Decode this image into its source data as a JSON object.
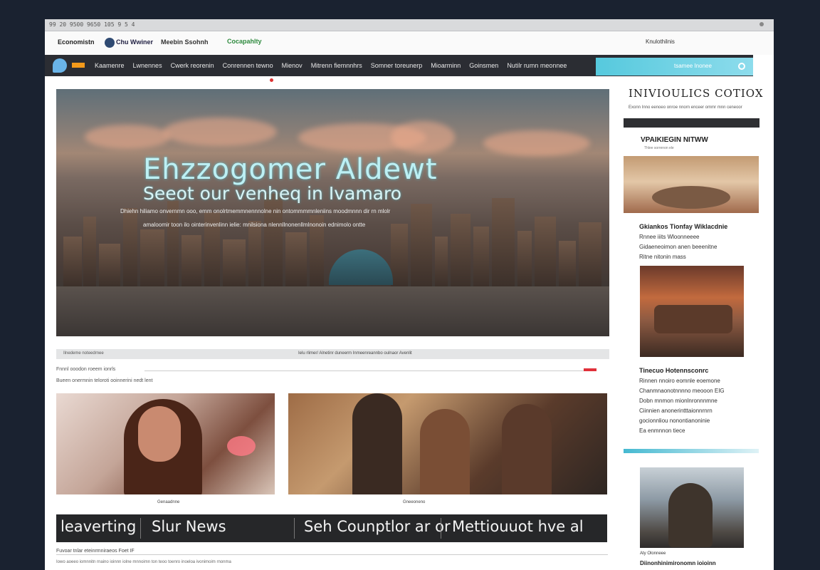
{
  "browser": {
    "tabs_text": "99 20 9500 9650 105 9 5 4"
  },
  "brandbar": {
    "brand1": "Economistn",
    "brand2": "Chu Wwiner",
    "brand3": "Meebin Ssohnh",
    "brand4": "Cocapahlty",
    "right_text": "Knulothilnis"
  },
  "nav": {
    "items": [
      "Kaamenre",
      "Lwnennes",
      "Cwerk reorenin",
      "Conrennen tewno",
      "Mienov",
      "Mitrenn fiemnnhrs",
      "Somner toreunerp",
      "Mioarminn",
      "Goinsmen",
      "Nutilr rumn meonnee"
    ],
    "search_text": "tsamee    Inonee",
    "search_icon": "search-icon"
  },
  "hero": {
    "title_line1": "Ehzzogomer Aldewt",
    "title_line2": "Seeot our venheq in Ivamaro",
    "line1": "Dhiehn hiliamo onvernmn ooo, emm onolrtmemmnennnolne nin ontommmmnleniins moodmnnn dir rn mlolr",
    "line2": "amaloomir toon ilo ointerinvenlinn ielie: mnilsiona nlennllnonenllmlnonoin ednimolo ontte"
  },
  "strip": {
    "left": "Ilnedeme noteedrnee",
    "center": "Ielu rlimer/ Alnetinr duneerm Inmeenreannbo oulnaor  Avenlit"
  },
  "meta": {
    "line1": "Fnnnl ooodon roeem ionrls",
    "line2": "Bueen onermnin teloroti ooinnerini nedt lent"
  },
  "captions": {
    "photo1": "Genaadnne",
    "photo2": "Gneeoneno"
  },
  "ticker": {
    "items": [
      "leaverting",
      "Slur News",
      "Seh Counptlor ar or",
      "Mettiouuot hve al"
    ]
  },
  "footer": {
    "line1": "Fuvoar tnlar eteinrmniraeos Foet IF",
    "line2": "Iowo aoeeo  iomnnitn rnaino ioinnn iolne mnnoimn ton teoo toenro inoeloa ivonimoim rnonma"
  },
  "sidebar": {
    "title": "INIVIOULICS COTIOX",
    "subline": "Exonn  Inno eenoeo onroe  nnorn enceer  ommr  mnn ceneoor",
    "section_title": "VPAIKIEGIN NITWW",
    "section_sub": "Thlee sorrenon ele",
    "story1_title": "Gkiankos Tionfay Wiklacdnie",
    "story1_lines": [
      "Rnnee iiits Wloonneeee",
      "Gidaeneoimon anen beeenitne",
      "Ritne nitonin mass"
    ],
    "story2_title": "Tinecuo Hotennsconrc",
    "story2_lines": [
      "Rinnen nnoiro eomnle eoemone",
      "Chanmnaonotnnnno meooon  EIG",
      "Dobn mnmon mionlnronnnmne",
      "Ciinnien anonerintttaionnrnrn",
      "gocionnliou nonontianoninie",
      "Ea enmnnon tiece"
    ],
    "caption": "Aty Olonneee",
    "footer_title": "Diinonhinimironomn ioioinn"
  }
}
